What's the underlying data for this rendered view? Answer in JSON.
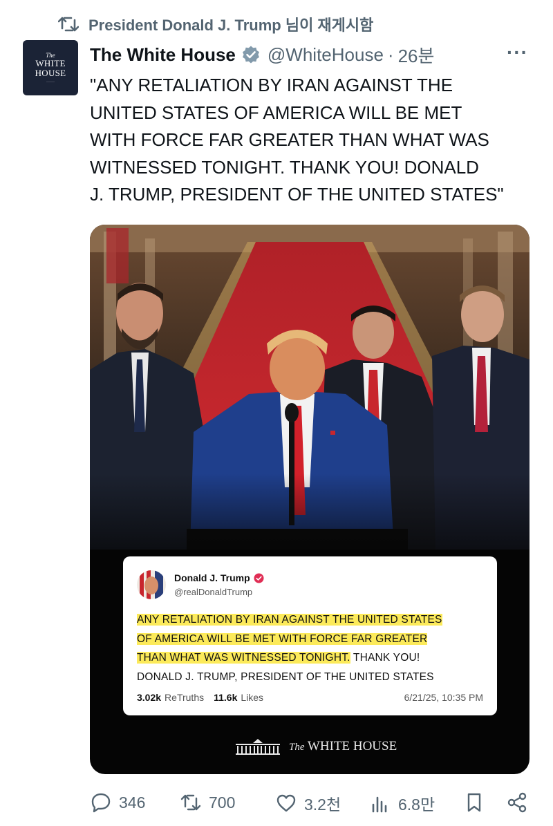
{
  "repost": {
    "text": "President Donald J. Trump 님이 재게시함"
  },
  "author": {
    "avatar_text_the": "The",
    "avatar_text_name": "WHITE HOUSE",
    "name": "The White House",
    "handle": "@WhiteHouse",
    "separator": "·",
    "time": "26분",
    "more": "···"
  },
  "tweet": {
    "text": "\"ANY RETALIATION BY IRAN AGAINST THE\nUNITED STATES OF AMERICA WILL BE MET\nWITH FORCE FAR GREATER THAN WHAT WAS\nWITNESSED TONIGHT. THANK YOU!  DONALD\nJ. TRUMP, PRESIDENT OF THE UNITED STATES\""
  },
  "embedded_post": {
    "name": "Donald J. Trump",
    "handle": "@realDonaldTrump",
    "highlight_1": "ANY RETALIATION BY IRAN AGAINST THE UNITED STATES",
    "highlight_2": "OF AMERICA WILL BE MET WITH FORCE FAR GREATER",
    "highlight_3": "THAN WHAT WAS WITNESSED TONIGHT.",
    "rest_1": " THANK YOU!",
    "rest_2": "DONALD J. TRUMP, PRESIDENT OF THE UNITED STATES",
    "retruths_count": "3.02k",
    "retruths_label": "ReTruths",
    "likes_count": "11.6k",
    "likes_label": "Likes",
    "date": "6/21/25, 10:35 PM"
  },
  "watermark": {
    "the": "The",
    "name": "WHITE HOUSE"
  },
  "actions": {
    "replies": "346",
    "reposts": "700",
    "likes": "3.2천",
    "views": "6.8만"
  },
  "colors": {
    "verified_gray": "#829aab",
    "muted_text": "#536471",
    "highlight": "#fcea5a",
    "carpet_red": "#c8262d"
  }
}
